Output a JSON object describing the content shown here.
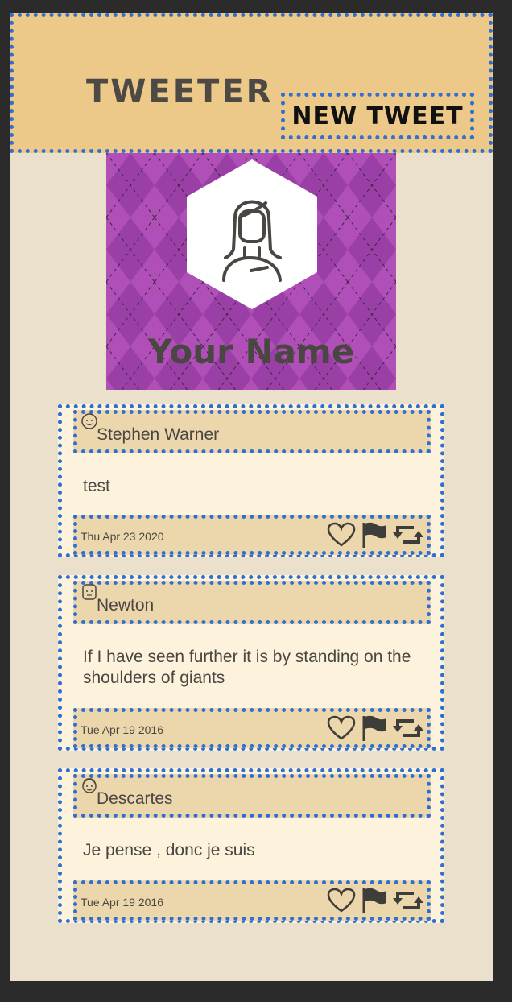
{
  "nav": {
    "brand": "Tweeter",
    "new_tweet_label": "New Tweet"
  },
  "profile": {
    "name": "Your Name",
    "avatar_icon": "woman-avatar-icon",
    "banner_color": "#b04fb8"
  },
  "tweets": [
    {
      "author": "Stephen Warner",
      "avatar_icon": "person-avatar-icon",
      "text": "test",
      "date": "Thu Apr 23 2020"
    },
    {
      "author": "Newton",
      "avatar_icon": "person-avatar-icon",
      "text": "If I have seen further it is by standing on the shoulders of giants",
      "date": "Tue Apr 19 2016"
    },
    {
      "author": "Descartes",
      "avatar_icon": "person-avatar-icon",
      "text": "Je pense , donc je suis",
      "date": "Tue Apr 19 2016"
    }
  ],
  "actions": [
    "heart-icon",
    "flag-icon",
    "retweet-icon"
  ],
  "colors": {
    "header_bg": "#ecc988",
    "outline": "#2f6fd1",
    "page_bg": "#eae0cb",
    "tweet_bg": "#fdf3dc"
  }
}
